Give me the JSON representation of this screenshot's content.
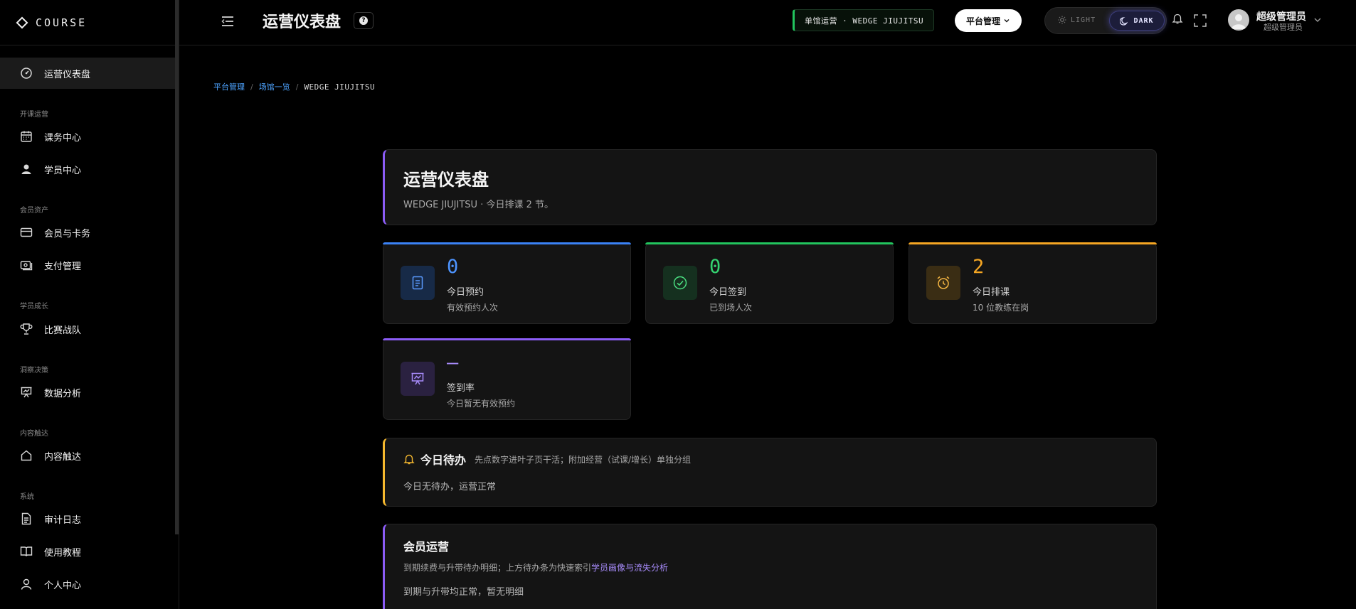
{
  "brand": {
    "name": "COURSE"
  },
  "sidebar": {
    "items": [
      {
        "label": "运营仪表盘",
        "icon": "gauge-icon"
      },
      {
        "label": "课务中心",
        "icon": "calendar-icon"
      },
      {
        "label": "学员中心",
        "icon": "user-icon"
      },
      {
        "label": "会员与卡务",
        "icon": "card-icon"
      },
      {
        "label": "支付管理",
        "icon": "payment-icon"
      },
      {
        "label": "比赛战队",
        "icon": "trophy-icon"
      },
      {
        "label": "数据分析",
        "icon": "presentation-icon"
      },
      {
        "label": "内容触达",
        "icon": "home-icon"
      },
      {
        "label": "审计日志",
        "icon": "document-icon"
      },
      {
        "label": "使用教程",
        "icon": "book-icon"
      },
      {
        "label": "个人中心",
        "icon": "user-outline-icon"
      }
    ],
    "sections": [
      "开课运营",
      "会员资产",
      "学员成长",
      "洞察决策",
      "内容触达",
      "系统"
    ]
  },
  "header": {
    "title": "运营仪表盘",
    "help": "?",
    "venue_badge": "单馆运营 · WEDGE JIUJITSU",
    "platform_button": "平台管理",
    "theme": {
      "light": "LIGHT",
      "dark": "DARK",
      "active": "dark"
    },
    "user": {
      "name": "超级管理员",
      "role": "超级管理员"
    }
  },
  "breadcrumb": [
    "平台管理",
    "场馆一览",
    "WEDGE JIUJITSU"
  ],
  "hero": {
    "title": "运营仪表盘",
    "subtitle": "WEDGE JIUJITSU · 今日排课 2 节。"
  },
  "stats": [
    {
      "value": "0",
      "label": "今日预约",
      "note": "有效预约人次",
      "color": "#3b82f6",
      "icon": "document-icon"
    },
    {
      "value": "0",
      "label": "今日签到",
      "note": "已到场人次",
      "color": "#22c55e",
      "icon": "check-circle-icon"
    },
    {
      "value": "2",
      "label": "今日排课",
      "note": "10 位教练在岗",
      "color": "#f5a623",
      "icon": "alarm-clock-icon"
    },
    {
      "value": "—",
      "label": "签到率",
      "note": "今日暂无有效预约",
      "color": "#8b5cf6",
      "icon": "presentation-icon"
    }
  ],
  "todo": {
    "title": "今日待办",
    "description": "先点数字进叶子页干活；附加经营（试课/增长）单独分组",
    "body": "今日无待办，运营正常"
  },
  "member": {
    "title": "会员运营",
    "description_prefix": "到期续费与升带待办明细；上方待办条为快速索引",
    "description_link": "学员画像与流失分析",
    "body": "到期与升带均正常，暂无明细"
  }
}
